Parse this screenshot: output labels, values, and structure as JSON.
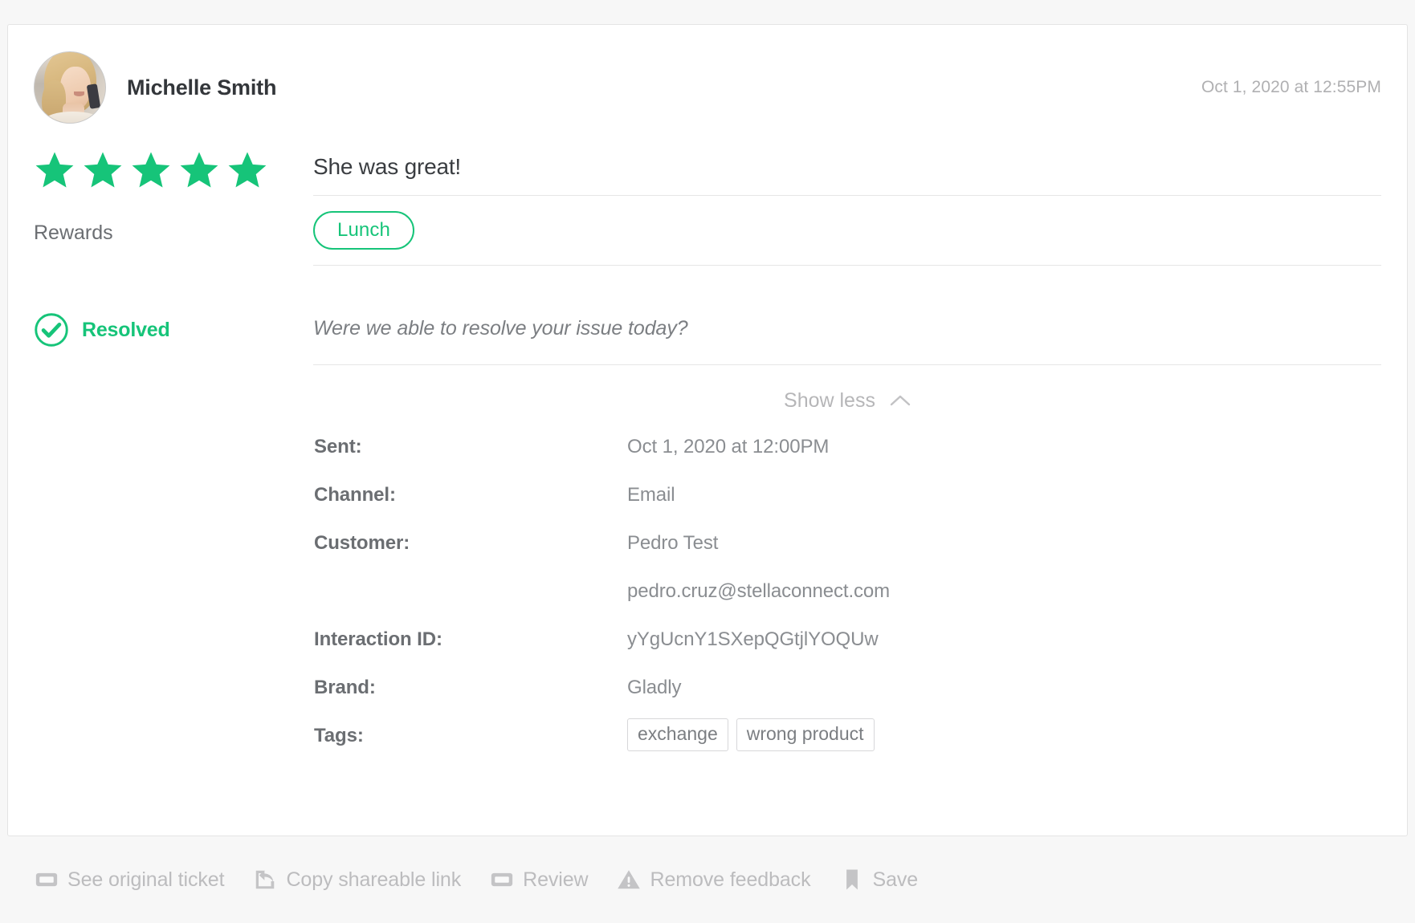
{
  "header": {
    "user_name": "Michelle Smith",
    "timestamp": "Oct 1, 2020 at 12:55PM",
    "avatar_alt": "avatar"
  },
  "rating": {
    "stars_filled": 5,
    "stars_total": 5,
    "star_color": "#16c479"
  },
  "review": {
    "title": "She was great!"
  },
  "rewards": {
    "label": "Rewards",
    "pill_label": "Lunch",
    "pill_color": "#16c479"
  },
  "resolution": {
    "status_label": "Resolved",
    "status_color": "#16c479",
    "question": "Were we able to resolve your issue today?"
  },
  "toggle": {
    "label": "Show less",
    "state": "expanded"
  },
  "details": [
    {
      "key": "Sent:",
      "value": "Oct 1, 2020 at 12:00PM"
    },
    {
      "key": "Channel:",
      "value": "Email"
    },
    {
      "key": "Customer:",
      "value": "Pedro Test"
    },
    {
      "key": "",
      "value": "pedro.cruz@stellaconnect.com"
    },
    {
      "key": "Interaction ID:",
      "value": "yYgUcnY1SXepQGtjlYOQUw"
    },
    {
      "key": "Brand:",
      "value": "Gladly"
    }
  ],
  "tags_row": {
    "key": "Tags:",
    "tags": [
      "exchange",
      "wrong product"
    ]
  },
  "footer": {
    "actions": [
      {
        "label": "See original ticket",
        "icon": "ticket-icon"
      },
      {
        "label": "Copy shareable link",
        "icon": "share-icon"
      },
      {
        "label": "Review",
        "icon": "ticket-icon"
      },
      {
        "label": "Remove feedback",
        "icon": "warning-icon"
      },
      {
        "label": "Save",
        "icon": "bookmark-icon"
      }
    ]
  }
}
